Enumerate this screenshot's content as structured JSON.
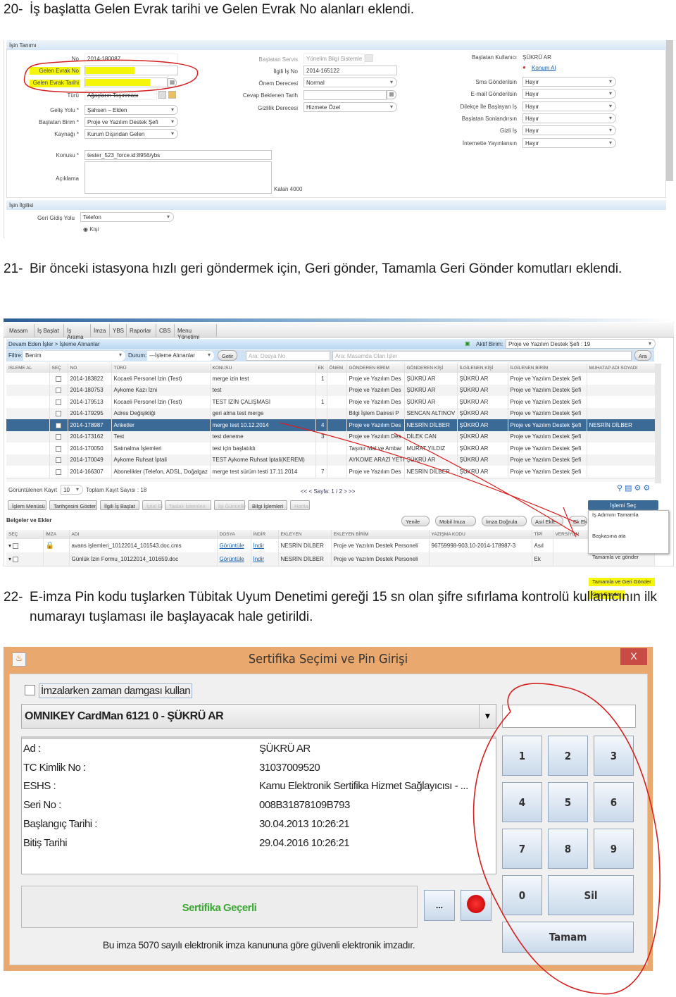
{
  "item20": {
    "num": "20-",
    "text": "İş başlatta Gelen Evrak tarihi ve Gelen Evrak No alanları eklendi."
  },
  "item21": {
    "num": "21-",
    "text": "Bir önceki istasyona hızlı geri göndermek için, Geri gönder, Tamamla Geri Gönder komutları eklendi."
  },
  "item22": {
    "num": "22-",
    "text": "E-imza Pin kodu tuşlarken Tübitak Uyum Denetimi gereği 15 sn olan şifre sıfırlama kontrolü kullanıcının ilk numarayı tuşlaması ile başlayacak hale getirildi."
  },
  "form": {
    "panel1": "İşin Tanımı",
    "panel2": "İşin İlgilisi",
    "no_label": "No",
    "no_value": "2014-180087",
    "gelen_evrak_no_label": "Gelen Evrak No",
    "gelen_evrak_tarihi_label": "Gelen Evrak Tarihi",
    "turu_label": "Türü",
    "turu_value": "Ağaçların Taşınması",
    "gelis_yolu_label": "Geliş Yolu *",
    "gelis_yolu_value": "Şahsen – Elden",
    "baslatan_birim_label": "Başlatan Birim *",
    "baslatan_birim_value": "Proje ve Yazılım Destek Şefi",
    "kaynagi_label": "Kaynağı *",
    "kaynagi_value": "Kurum Dışından Gelen",
    "konusu_label": "Konusu *",
    "konusu_value": "tester_523_force.id:8956/ybs",
    "aciklama_label": "Açıklama",
    "kalan": "Kalan 4000",
    "baslatan_servis_label": "Başlatan Servis",
    "baslatan_servis_value": "Yönelim Bilgi Sistemle",
    "ilgili_is_no_label": "İlgili İş No",
    "ilgili_is_no_value": "2014-165122",
    "onem_label": "Önem Derecesi",
    "onem_value": "Normal",
    "cevap_label": "Cevap Beklenen Tarih",
    "gizlilik_label": "Gizlilik Derecesi",
    "gizlilik_value": "Hizmete Özel",
    "baslatan_kullanici_label": "Başlatan Kullanıcı",
    "baslatan_kullanici_value": "ŞÜKRÜ AR",
    "konum_al": "Konum Al",
    "flags": [
      {
        "label": "Sms Gönderilsin",
        "value": "Hayır"
      },
      {
        "label": "E-mail Gönderilsin",
        "value": "Hayır"
      },
      {
        "label": "Dilekçe İle Başlayan İş",
        "value": "Hayır"
      },
      {
        "label": "Başlatan Sonlandırsın",
        "value": "Hayır"
      },
      {
        "label": "Gizli İş",
        "value": "Hayır"
      },
      {
        "label": "İnternette Yayınlansın",
        "value": "Hayır"
      }
    ],
    "geri_donus_label": "Geri Gidiş Yolu",
    "geri_donus_value": "Telefon",
    "kisi": "Kişi"
  },
  "app": {
    "tabs": [
      "Masam",
      "İş Başlat",
      "İş Arama",
      "İmza",
      "YBS",
      "Raporlar",
      "CBS",
      "Menu Yönetimi"
    ],
    "breadcrumb": "Devam Eden İşler > İşleme Alınanlar",
    "aktif_birim_label": "Aktif Birim:",
    "aktif_birim_value": "Proje ve Yazılım Destek Şefi : 19",
    "filtre_label": "Filtre:",
    "filtre_value": "Benim",
    "durum_label": "Durum:",
    "durum_value": "---İşleme Alınanlar",
    "getir": "Getir",
    "search1_placeholder": "Ara: Dosya No",
    "search2_placeholder": "Ara: Masamda Olan İşler",
    "ara": "Ara",
    "columns": [
      "ISLEME AL",
      "SEÇ",
      "NO",
      "TÜRÜ",
      "KONUSU",
      "EK",
      "ÖNEM",
      "GÖNDEREN BİRİM",
      "GÖNDEREN KİŞİ",
      "İLGİLENEN KİŞİ",
      "İLGİLENEN BİRİM",
      "MUHATAP ADI SOYADI"
    ],
    "rows": [
      [
        "",
        "",
        "2014-183822",
        "Kocaeli Personel İzin (Test)",
        "merge izin test",
        "1",
        "",
        "Proje ve Yazılım Des",
        "ŞÜKRÜ AR",
        "ŞÜKRÜ AR",
        "Proje ve Yazılım Destek Şefi",
        ""
      ],
      [
        "",
        "",
        "2014-180753",
        "Aykome Kazı İzni",
        "test",
        "",
        "",
        "Proje ve Yazılım Des",
        "ŞÜKRÜ AR",
        "ŞÜKRÜ AR",
        "Proje ve Yazılım Destek Şefi",
        ""
      ],
      [
        "",
        "",
        "2014-179513",
        "Kocaeli Personel İzin (Test)",
        "TEST İZİN ÇALIŞMASI",
        "1",
        "",
        "Proje ve Yazılım Des",
        "ŞÜKRÜ AR",
        "ŞÜKRÜ AR",
        "Proje ve Yazılım Destek Şefi",
        ""
      ],
      [
        "",
        "",
        "2014-179295",
        "Adres Değişikliği",
        "geri alma test merge",
        "",
        "",
        "Bilgi İşlem Dairesi P",
        "SENCAN ALTINOV",
        "ŞÜKRÜ AR",
        "Proje ve Yazılım Destek Şefi",
        ""
      ],
      [
        "",
        "",
        "2014-178987",
        "Anketler",
        "merge test 10.12.2014",
        "4",
        "",
        "Proje ve Yazılım Des",
        "NESRİN DİLBER",
        "ŞÜKRÜ AR",
        "Proje ve Yazılım Destek Şefi",
        "NESRİN DİLBER"
      ],
      [
        "",
        "",
        "2014-173162",
        "Test",
        "test deneme",
        "3",
        "",
        "Proje ve Yazılım Des",
        "DİLEK CAN",
        "ŞÜKRÜ AR",
        "Proje ve Yazılım Destek Şefi",
        ""
      ],
      [
        "",
        "",
        "2014-170050",
        "Satınalma İşlemleri",
        "test için başlatıldı",
        "",
        "",
        "Taşınır Mal ve Ambar",
        "MURAT YILDIZ",
        "ŞÜKRÜ AR",
        "Proje ve Yazılım Destek Şefi",
        ""
      ],
      [
        "",
        "",
        "2014-170049",
        "Aykome Ruhsat İptali",
        "TEST Aykome Ruhsat İptali(KEREM)",
        "",
        "",
        "AYKOME ARAZİ YETK",
        "ŞÜKRÜ AR",
        "ŞÜKRÜ AR",
        "Proje ve Yazılım Destek Şefi",
        ""
      ],
      [
        "",
        "",
        "2014-166307",
        "Abonelikler (Telefon, ADSL, Doğalgaz",
        "merge test sürüm testi 17.11.2014",
        "7",
        "",
        "Proje ve Yazılım Des",
        "NESRİN DİLBER",
        "ŞÜKRÜ AR",
        "Proje ve Yazılım Destek Şefi",
        ""
      ]
    ],
    "selected_row": 4,
    "goruntulenen_label": "Görüntülenen Kayıt",
    "goruntulenen_value": "10",
    "toplam": "Toplam Kayıt Sayısı : 18",
    "sayfa": "<< < Sayfa: 1 / 2 > >>",
    "actions": [
      {
        "label": "İşlem Menüsü",
        "enabled": true
      },
      {
        "label": "Tarihçesini Göster",
        "enabled": true
      },
      {
        "label": "İlgili İş Başlat",
        "enabled": true
      },
      {
        "label": "İptal Et",
        "enabled": false
      },
      {
        "label": "Taslak İstemlen",
        "enabled": false
      },
      {
        "label": "İşi Güncelle",
        "enabled": false
      },
      {
        "label": "Bilgi İşlemleri",
        "enabled": true
      },
      {
        "label": "Harita",
        "enabled": false
      }
    ],
    "islemi_sec": "İşlemi Seç",
    "belgeler": "Belgeler ve Ekler",
    "doc_buttons": [
      "Yenile",
      "Mobil İmza",
      "İmza Doğrula",
      "Asıl Ekle",
      "Ek Ekle"
    ],
    "doc_columns": [
      "SEÇ",
      "İMZA",
      "ADI",
      "DOSYA",
      "İNDİR",
      "EKLEYEN",
      "EKLEYEN BİRİM",
      "YAZIŞMA KODU",
      "TİPİ",
      "VERSİYON"
    ],
    "docs": [
      [
        "",
        "",
        "avans işlemleri_10122014_101543.doc.cms",
        "Görüntüle",
        "İndir",
        "NESRİN DİLBER",
        "Proje ve Yazılım Destek Personeli",
        "96759998-903.10-2014-178987-3",
        "Asıl",
        ""
      ],
      [
        "",
        "",
        "Günlük İzin Formu_10122014_101659.doc",
        "Görüntüle",
        "İndir",
        "NESRİN DİLBER",
        "Proje ve Yazılım Destek Personeli",
        "",
        "Ek",
        ""
      ]
    ],
    "menu": [
      "İş Adımını Tamamla",
      "Başkasına ata",
      "Tamamla ve gönder",
      "Tamamla ve Geri Gönder",
      "Geri Gönder"
    ],
    "highlight_color": "#f5f50a"
  },
  "dialog": {
    "title": "Sertifika Seçimi ve Pin Girişi",
    "close": "X",
    "timestamp_checkbox": "İmzalarken zaman damgası kullan",
    "card": "OMNIKEY CardMan 6121 0 - ŞÜKRÜ AR",
    "fields": [
      {
        "label": "Ad :",
        "value": "ŞÜKRÜ AR"
      },
      {
        "label": "TC Kimlik No :",
        "value": "31037009520"
      },
      {
        "label": "ESHS :",
        "value": "Kamu Elektronik Sertifika Hizmet Sağlayıcısı - ..."
      },
      {
        "label": "Seri No :",
        "value": "008B31878109B793"
      },
      {
        "label": "Başlangıç Tarihi :",
        "value": "30.04.2013 10:26:21"
      },
      {
        "label": "Bitiş Tarihi",
        "value": "29.04.2016 10:26:21"
      }
    ],
    "status": "Sertifika Geçerli",
    "browse": "...",
    "keys": [
      "1",
      "2",
      "3",
      "4",
      "5",
      "6",
      "7",
      "8",
      "9",
      "0"
    ],
    "sil": "Sil",
    "tamam": "Tamam",
    "footer": "Bu imza 5070 sayılı elektronik imza kanununa göre güvenli elektronik imzadır.",
    "title_color": "#e9a86d",
    "status_color": "#3aa832"
  }
}
